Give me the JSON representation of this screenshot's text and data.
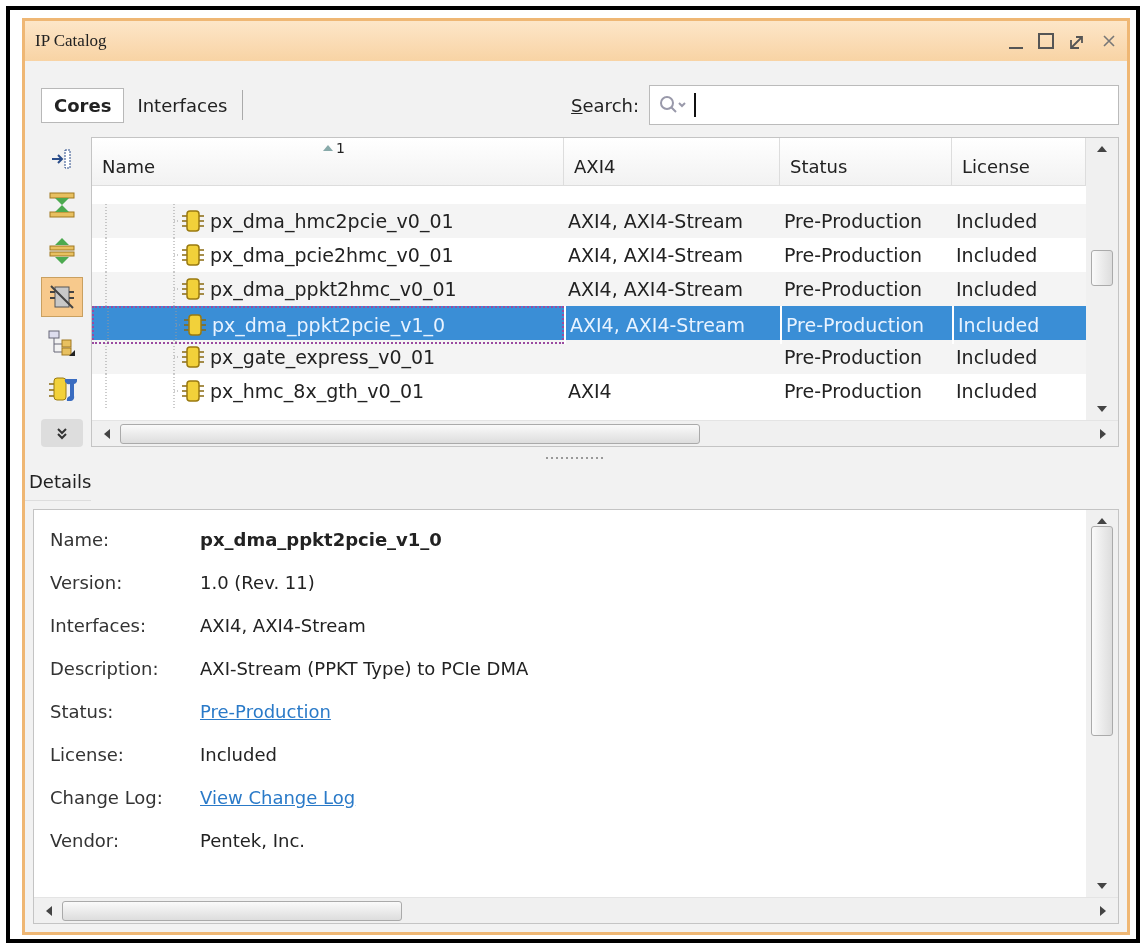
{
  "window": {
    "title": "IP Catalog"
  },
  "tabs": [
    {
      "label": "Cores",
      "selected": true
    },
    {
      "label": "Interfaces",
      "selected": false
    }
  ],
  "search": {
    "label": "Search:"
  },
  "toolbar": [
    {
      "kind": "expand-panel",
      "pressed": false
    },
    {
      "kind": "collapse-all",
      "pressed": false
    },
    {
      "kind": "expand-all",
      "pressed": false
    },
    {
      "kind": "hide-unsupported",
      "pressed": true
    },
    {
      "kind": "hierarchy",
      "pressed": false
    },
    {
      "kind": "customize",
      "pressed": false
    },
    {
      "kind": "more",
      "pressed": false
    }
  ],
  "table": {
    "columns": [
      {
        "label": "Name",
        "sort_rank": "1"
      },
      {
        "label": "AXI4"
      },
      {
        "label": "Status"
      },
      {
        "label": "License"
      }
    ],
    "rows": [
      {
        "name": "px_dma_hmc2pcie_v0_01",
        "axi4": "AXI4, AXI4-Stream",
        "status": "Pre-Production",
        "license": "Included",
        "selected": false
      },
      {
        "name": "px_dma_pcie2hmc_v0_01",
        "axi4": "AXI4, AXI4-Stream",
        "status": "Pre-Production",
        "license": "Included",
        "selected": false
      },
      {
        "name": "px_dma_ppkt2hmc_v0_01",
        "axi4": "AXI4, AXI4-Stream",
        "status": "Pre-Production",
        "license": "Included",
        "selected": false
      },
      {
        "name": "px_dma_ppkt2pcie_v1_0",
        "axi4": "AXI4, AXI4-Stream",
        "status": "Pre-Production",
        "license": "Included",
        "selected": true
      },
      {
        "name": "px_gate_express_v0_01",
        "status": "Pre-Production",
        "license": "Included",
        "selected": false
      },
      {
        "name": "px_hmc_8x_gth_v0_01",
        "axi4": "AXI4",
        "status": "Pre-Production",
        "license": "Included",
        "selected": false
      }
    ]
  },
  "details": {
    "title": "Details",
    "fields": [
      {
        "label": "Name:",
        "value": "px_dma_ppkt2pcie_v1_0",
        "kind": "bold"
      },
      {
        "label": "Version:",
        "value": "1.0 (Rev. 11)",
        "kind": "text"
      },
      {
        "label": "Interfaces:",
        "value": "AXI4, AXI4-Stream",
        "kind": "text"
      },
      {
        "label": "Description:",
        "value": "AXI-Stream (PPKT Type) to PCIe DMA",
        "kind": "text"
      },
      {
        "label": "Status:",
        "value": "Pre-Production",
        "kind": "link"
      },
      {
        "label": "License:",
        "value": "Included",
        "kind": "text"
      },
      {
        "label": "Change Log:",
        "value": "View Change Log",
        "kind": "link"
      },
      {
        "label": "Vendor:",
        "value": "Pentek, Inc.",
        "kind": "text"
      }
    ]
  }
}
